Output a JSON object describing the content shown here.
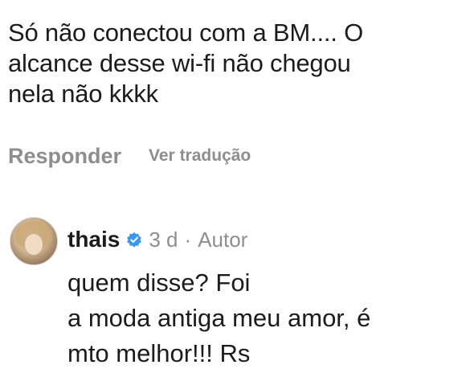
{
  "comment": {
    "text": "Só não conectou com a BM.... O\nalcance desse wi-fi não chegou\nnela não kkkk",
    "reply_label": "Responder",
    "translate_label": "Ver tradução"
  },
  "reply": {
    "username": "thais",
    "verified_icon": "verified-badge-icon",
    "time": "3 d",
    "separator": "·",
    "role": "Autor",
    "text": "quem disse? Foi\na moda antiga meu amor, é\nmto melhor!!! Rs"
  },
  "colors": {
    "text": "#1c1c1c",
    "muted": "#8e8e8e",
    "verified": "#3897f0"
  }
}
